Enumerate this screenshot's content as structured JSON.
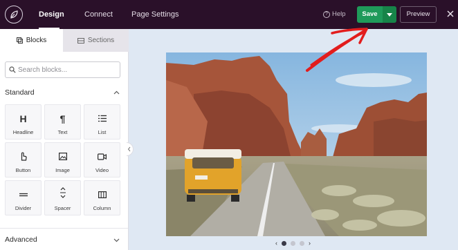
{
  "header": {
    "tabs": [
      {
        "label": "Design",
        "active": true
      },
      {
        "label": "Connect",
        "active": false
      },
      {
        "label": "Page Settings",
        "active": false
      }
    ],
    "help_label": "Help",
    "save_label": "Save",
    "preview_label": "Preview"
  },
  "sidebar": {
    "tabs": [
      {
        "label": "Blocks",
        "icon": "blocks-icon",
        "active": true
      },
      {
        "label": "Sections",
        "icon": "sections-icon",
        "active": false
      }
    ],
    "search": {
      "placeholder": "Search blocks..."
    },
    "standard": {
      "title": "Standard",
      "blocks": [
        {
          "label": "Headline",
          "icon": "headline-icon"
        },
        {
          "label": "Text",
          "icon": "paragraph-icon"
        },
        {
          "label": "List",
          "icon": "list-icon"
        },
        {
          "label": "Button",
          "icon": "pointer-icon"
        },
        {
          "label": "Image",
          "icon": "image-icon"
        },
        {
          "label": "Video",
          "icon": "video-icon"
        },
        {
          "label": "Divider",
          "icon": "divider-icon"
        },
        {
          "label": "Spacer",
          "icon": "spacer-icon"
        },
        {
          "label": "Column",
          "icon": "column-icon"
        }
      ]
    },
    "advanced": {
      "title": "Advanced"
    }
  },
  "canvas": {
    "carousel": {
      "total": 3,
      "active": 1
    }
  },
  "colors": {
    "topbar": "#2a1029",
    "save": "#1f9a5a",
    "annotation": "#e21d1d"
  }
}
